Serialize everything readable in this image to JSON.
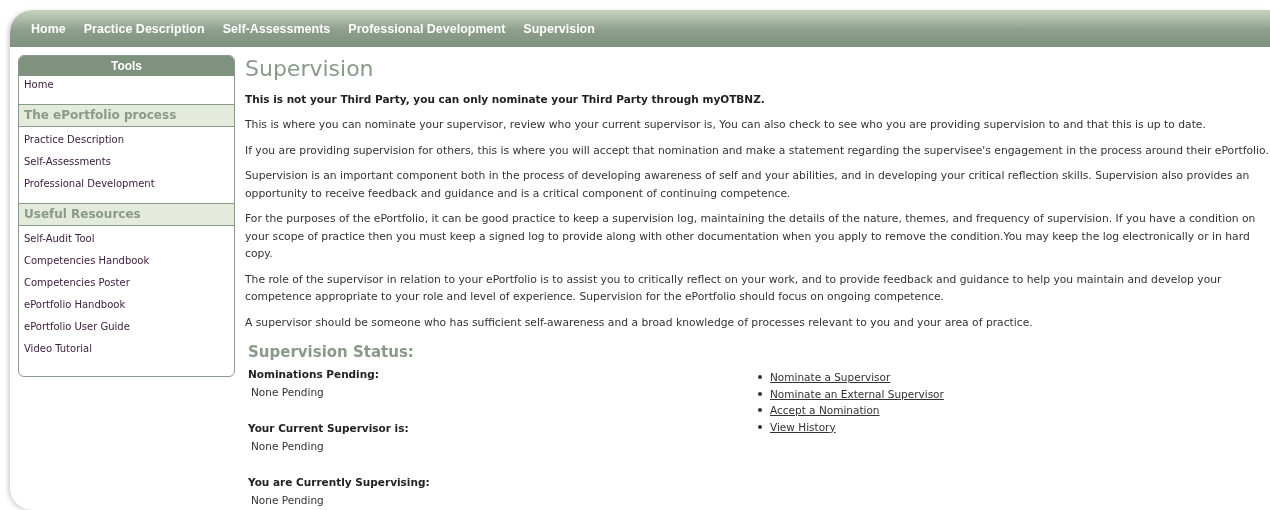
{
  "nav": [
    {
      "label": "Home"
    },
    {
      "label": "Practice Description"
    },
    {
      "label": "Self-Assessments"
    },
    {
      "label": "Professional Development"
    },
    {
      "label": "Supervision"
    }
  ],
  "sidebar": {
    "title": "Tools",
    "sections": [
      {
        "items": [
          "Home"
        ]
      },
      {
        "heading": "The ePortfolio process",
        "items": [
          "Practice Description",
          "Self-Assessments",
          "Professional Development"
        ]
      },
      {
        "heading": "Useful Resources",
        "items": [
          "Self-Audit Tool",
          "Competencies Handbook",
          "Competencies Poster",
          "ePortfolio Handbook",
          "ePortfolio User Guide",
          "Video Tutorial"
        ]
      }
    ]
  },
  "page_title": "Supervision",
  "notice": "This is not your Third Party, you can only nominate your Third Party through myOTBNZ.",
  "paragraphs": [
    "This is where you can nominate your supervisor, review who your current supervisor is, You can also check to see who you are providing supervision to and that this is up to date.",
    "If you are providing supervision for others, this is where you will accept that nomination and make a statement regarding the supervisee's engagement in the process around their ePortfolio.",
    "Supervision is an important component both in the process of developing awareness of self and your abilities, and in developing your critical reflection skills. Supervision also provides an opportunity to receive feedback and guidance and is a critical component of continuing competence.",
    "For the purposes of the ePortfolio, it can be good practice to keep a supervision log, maintaining the details of the nature, themes, and frequency of supervision. If you have a condition on your scope of practice then you must keep a signed log to provide along with other documentation when you apply to remove the condition.You may keep the log electronically or in hard copy.",
    "The role of the supervisor in relation to your ePortfolio is to assist you to critically reflect on your work, and to provide feedback and guidance to help you maintain and develop your competence appropriate to your role and level of experience. Supervision for the ePortfolio should focus on ongoing competence.",
    "A supervisor should be someone who has sufficient self-awareness and a broad knowledge of processes relevant to you and your area of practice."
  ],
  "status": {
    "title": "Supervision Status:",
    "groups": [
      {
        "label": "Nominations Pending:",
        "value": "None Pending"
      },
      {
        "label": "Your Current Supervisor is:",
        "value": "None Pending"
      },
      {
        "label": "You are Currently Supervising:",
        "value": "None Pending"
      }
    ],
    "links": [
      "Nominate a Supervisor",
      "Nominate an External Supervisor",
      "Accept a Nomination",
      "View History"
    ]
  }
}
